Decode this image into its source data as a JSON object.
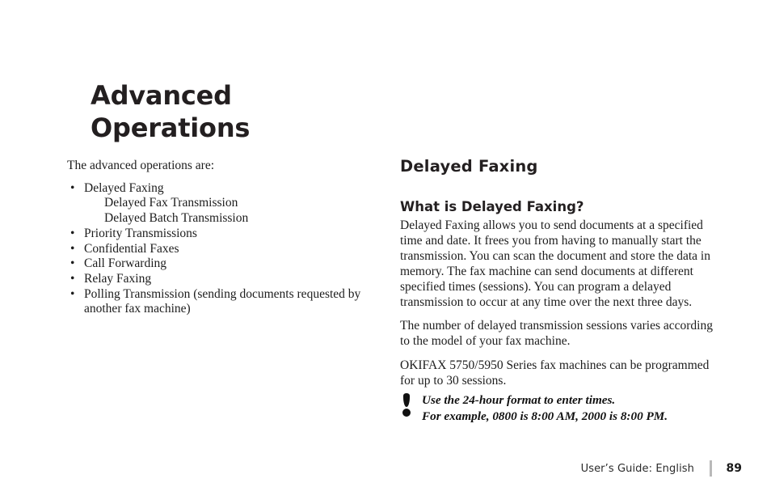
{
  "chapter": {
    "title_line1": "Advanced",
    "title_line2": "Operations"
  },
  "left_column": {
    "intro": "The advanced operations are:",
    "bullet_glyph": "•",
    "items": [
      {
        "label": "Delayed Faxing",
        "subitems": [
          "Delayed Fax Transmission",
          "Delayed Batch Transmission"
        ]
      },
      {
        "label": "Priority Transmissions",
        "subitems": []
      },
      {
        "label": "Confidential  Faxes",
        "subitems": []
      },
      {
        "label": "Call Forwarding",
        "subitems": []
      },
      {
        "label": "Relay Faxing",
        "subitems": []
      },
      {
        "label": "Polling Transmission (sending documents requested by another fax machine)",
        "subitems": []
      }
    ]
  },
  "right_column": {
    "section_heading": "Delayed  Faxing",
    "sub_heading": "What is Delayed Faxing?",
    "paragraphs": [
      "Delayed Faxing allows you to send documents at a specified time and date.  It frees you from having to manually start the transmission.  You can scan the document and store the data in memory. The fax machine can send documents at different specified times (sessions). You can program a delayed transmission to occur at any time over the next three days.",
      "The number of delayed transmission sessions varies according to the model of your fax machine.",
      "OKIFAX 5750/5950 Series fax machines can be programmed for up to 30 sessions."
    ]
  },
  "note": {
    "icon": "exclamation-icon",
    "line1": "Use the 24-hour format to enter times.",
    "line2": "For example, 0800 is 8:00 AM, 2000 is 8:00 PM."
  },
  "footer": {
    "label": "User’s Guide:  English",
    "page_number": "89"
  },
  "colors": {
    "text": "#1d1d1d",
    "heading": "#231f20",
    "rule": "#b9b9b9",
    "background": "#ffffff"
  }
}
